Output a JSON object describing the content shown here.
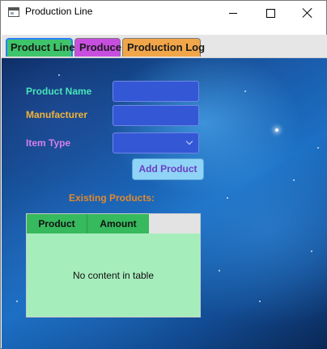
{
  "window": {
    "title": "Production Line",
    "controls": {
      "minimize": "minimize-icon",
      "maximize": "maximize-icon",
      "close": "close-icon"
    }
  },
  "tabs": [
    {
      "label": "Product Line",
      "color": "#3ec46a",
      "selected": true
    },
    {
      "label": "Produce",
      "color": "#c84ee0",
      "selected": false
    },
    {
      "label": "Production Log",
      "color": "#f1a649",
      "selected": false
    }
  ],
  "form": {
    "product_name": {
      "label": "Product Name",
      "value": ""
    },
    "manufacturer": {
      "label": "Manufacturer",
      "value": ""
    },
    "item_type": {
      "label": "Item Type",
      "value": ""
    },
    "add_button": "Add Product"
  },
  "existing_products": {
    "label": "Existing Products:",
    "columns": [
      "Product",
      "Amount"
    ],
    "placeholder": "No content in table",
    "header_color": "#37b95e",
    "body_color": "#a6edbc"
  }
}
